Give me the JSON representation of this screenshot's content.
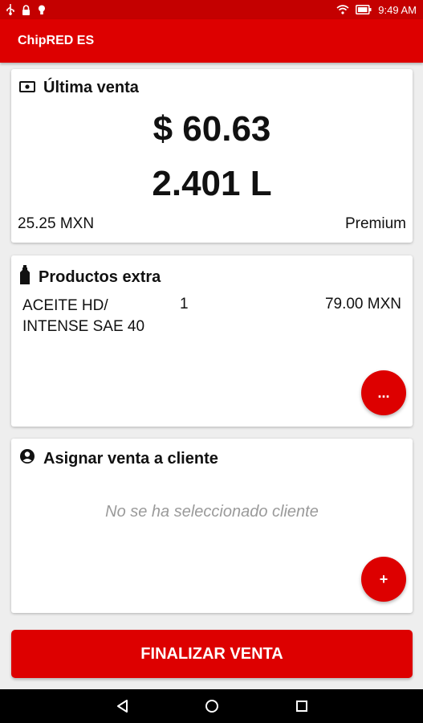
{
  "status_bar": {
    "time": "9:49 AM",
    "icons": [
      "usb-icon",
      "lock-icon",
      "bulb-icon",
      "wifi-icon",
      "battery-icon"
    ]
  },
  "app_bar": {
    "title": "ChipRED ES"
  },
  "last_sale": {
    "title": "Última venta",
    "icon": "money-icon",
    "amount": "$ 60.63",
    "volume": "2.401 L",
    "unit_price": "25.25 MXN",
    "product": "Premium"
  },
  "extra_products": {
    "title": "Productos extra",
    "icon": "bottle-icon",
    "items": [
      {
        "name": "ACEITE HD/ INTENSE SAE 40",
        "quantity": "1",
        "price": "79.00 MXN"
      }
    ],
    "more_button": "..."
  },
  "assign_client": {
    "title": "Asignar venta a cliente",
    "icon": "account-icon",
    "empty_text": "No se ha seleccionado cliente",
    "add_button": "+"
  },
  "finalize_button": "FINALIZAR VENTA",
  "nav_bar": {
    "icons": [
      "back-icon",
      "home-icon",
      "recents-icon"
    ]
  },
  "colors": {
    "primary": "#dd0000",
    "status_bar": "#c40000",
    "background": "#eeeeee",
    "placeholder": "#9a9a9a"
  }
}
